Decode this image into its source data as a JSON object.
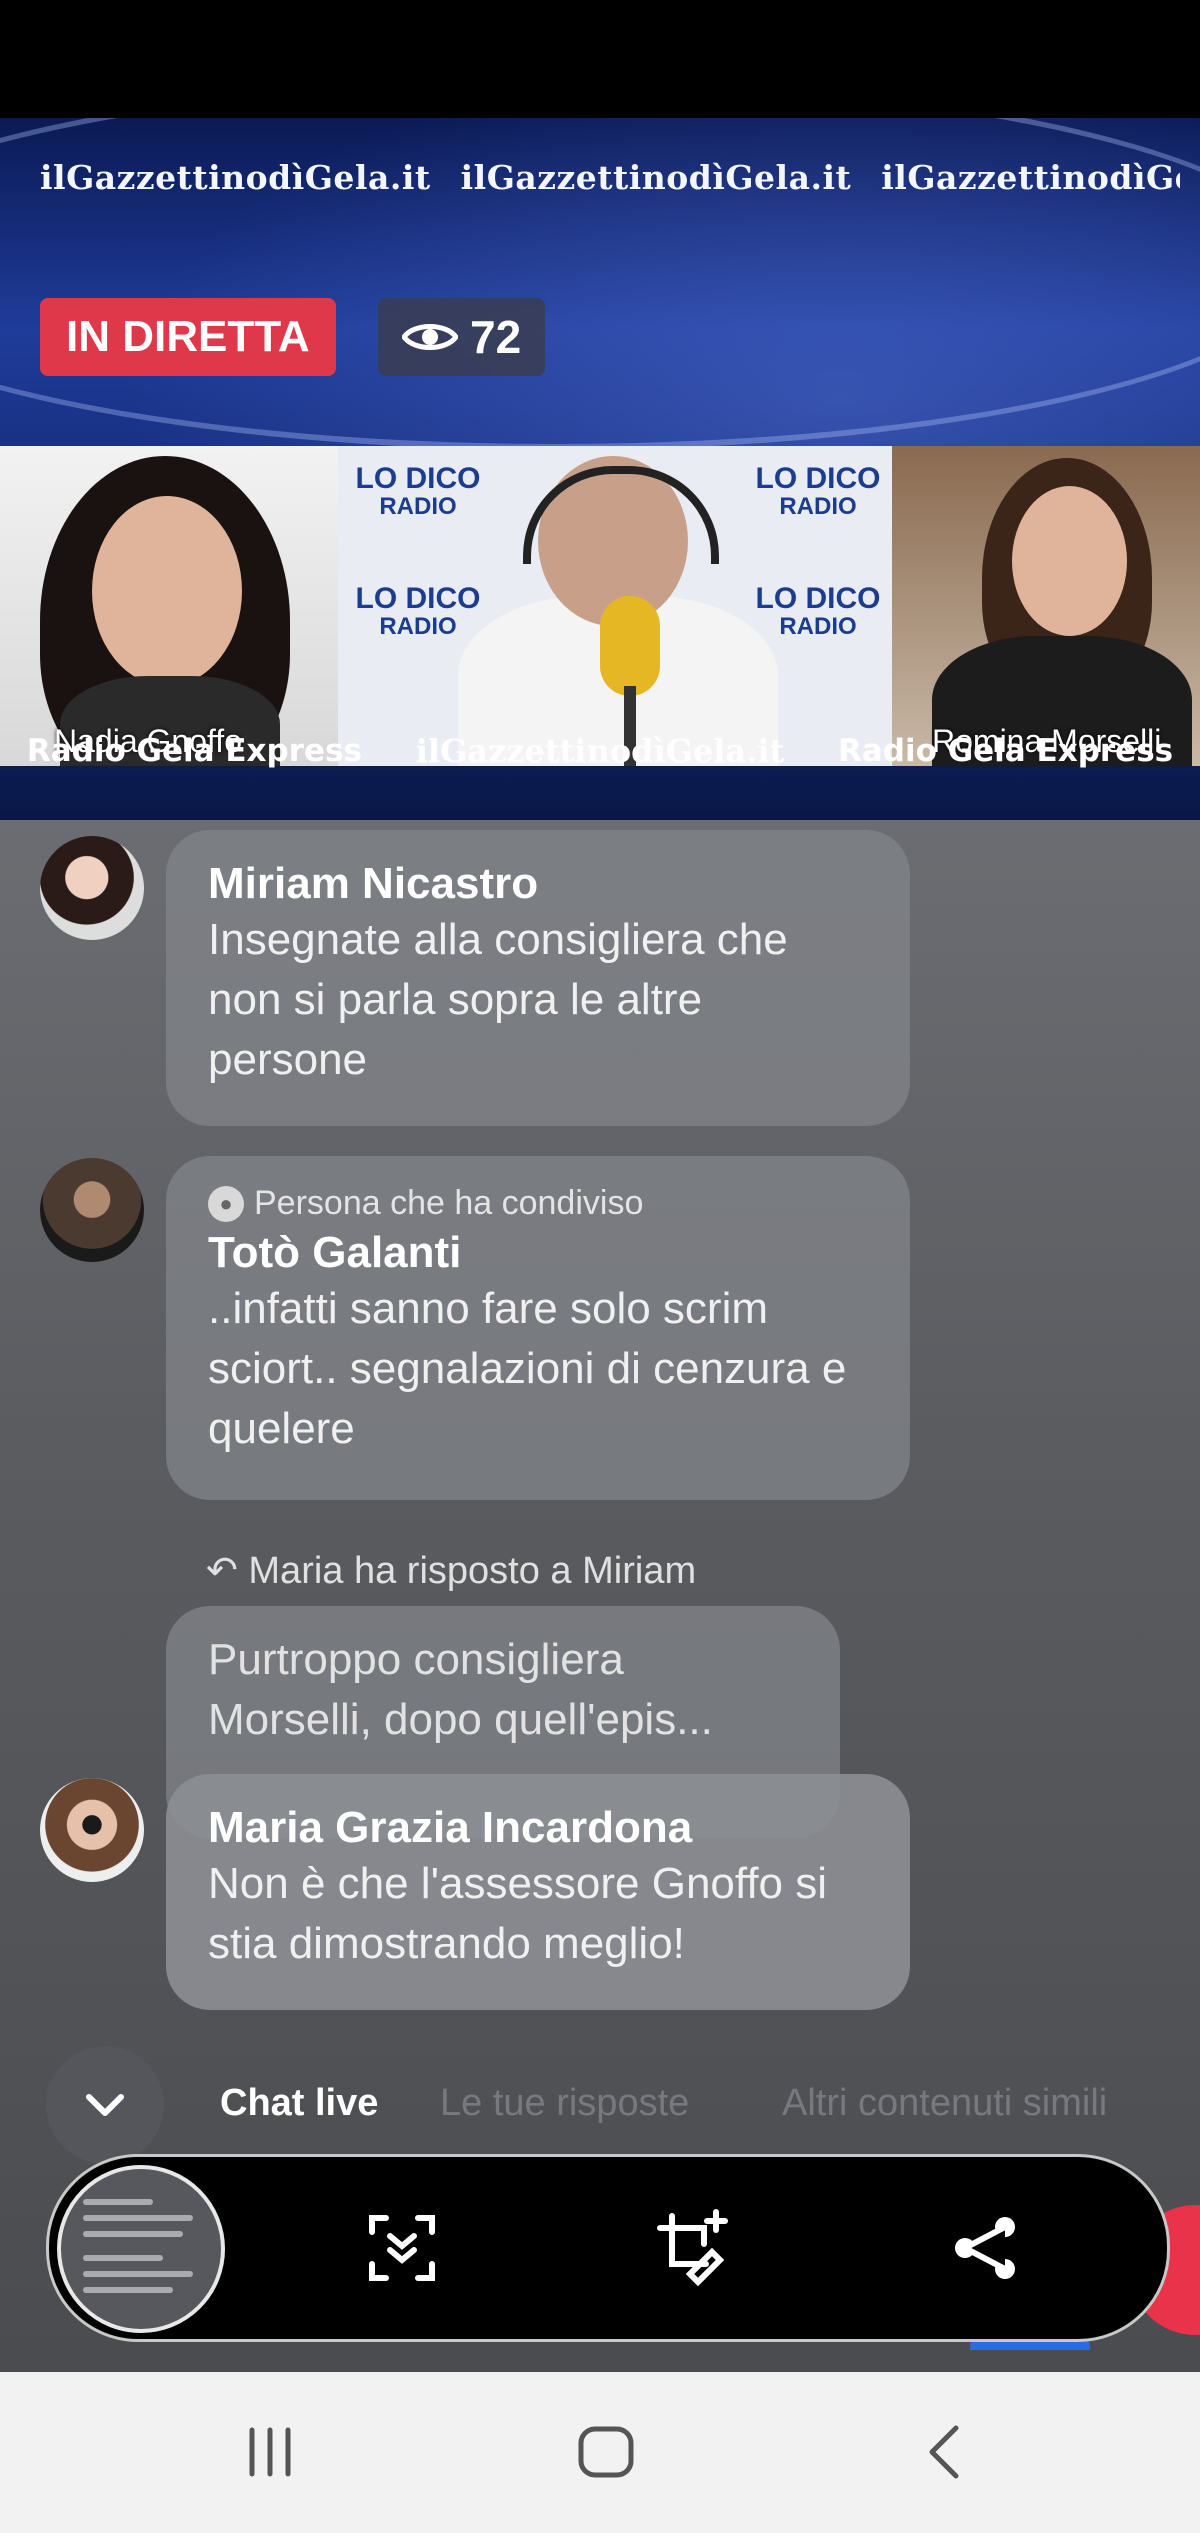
{
  "video": {
    "ticker_top": [
      "ilGazzettinodìGela.it",
      "ilGazzettinodìGela.it",
      "ilGazzettinodìGela.it"
    ],
    "ticker_bottom": [
      "Radio Gela Express",
      "ilGazzettinodìGela.it",
      "Radio Gela Express"
    ],
    "live_label": "IN DIRETTA",
    "viewer_count": "72",
    "guest_left": "Nadia Gnoffo",
    "guest_right": "Romina Morselli",
    "studio_logo": "LO DICO ALLA RADIO"
  },
  "chat": {
    "messages": [
      {
        "author": "Miriam Nicastro",
        "text": "Insegnate alla consigliera che non si parla sopra le altre persone"
      },
      {
        "shared_label": "Persona che ha condiviso",
        "author": "Totò Galanti",
        "text": "..infatti sanno fare solo scrim sciort.. segnalazioni di cenzura e quelere"
      },
      {
        "reply_label": "Maria ha risposto a Miriam",
        "quoted_text": "Purtroppo consigliera Morselli,  dopo quell'epis...",
        "author": "Maria Grazia Incardona",
        "text": "Non è che l'assessore Gnoffo si stia dimostrando meglio!"
      }
    ]
  },
  "tabs": [
    "Chat live",
    "Le tue risposte",
    "Altri contenuti simili"
  ],
  "toolbar": {
    "icons": [
      "scroll-capture-icon",
      "crop-edit-icon",
      "share-icon"
    ]
  },
  "colors": {
    "live_red": "#e0384b",
    "toolbar_bg": "#000000",
    "navbar_bg": "#f2f2f2"
  }
}
